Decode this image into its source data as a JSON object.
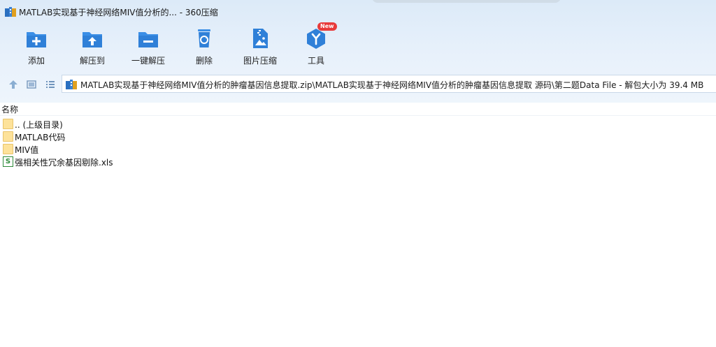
{
  "window": {
    "title": "MATLAB实现基于神经网络MIV值分析的... - 360压缩"
  },
  "toolbar": {
    "items": [
      {
        "label": "添加",
        "icon": "add-icon"
      },
      {
        "label": "解压到",
        "icon": "extract-to-icon"
      },
      {
        "label": "一键解压",
        "icon": "one-click-extract-icon"
      },
      {
        "label": "删除",
        "icon": "delete-icon"
      },
      {
        "label": "图片压缩",
        "icon": "image-compress-icon"
      },
      {
        "label": "工具",
        "icon": "tools-icon",
        "badge": "New"
      }
    ]
  },
  "address": {
    "path": "MATLAB实现基于神经网络MIV值分析的肿瘤基因信息提取.zip\\MATLAB实现基于神经网络MIV值分析的肿瘤基因信息提取 源码\\第二题Data File - 解包大小为 39.4 MB"
  },
  "list": {
    "column_name": "名称",
    "items": [
      {
        "name": ".. (上级目录)",
        "type": "folder"
      },
      {
        "name": "MATLAB代码",
        "type": "folder"
      },
      {
        "name": "MIV值",
        "type": "folder"
      },
      {
        "name": "强相关性冗余基因剔除.xls",
        "type": "xls",
        "icon_letter": "S"
      }
    ]
  },
  "colors": {
    "accent": "#2f8be0",
    "header_bg": "#e3eefa",
    "folder": "#fde29a",
    "xls": "#2e8b3a",
    "badge": "#e83a3a"
  }
}
